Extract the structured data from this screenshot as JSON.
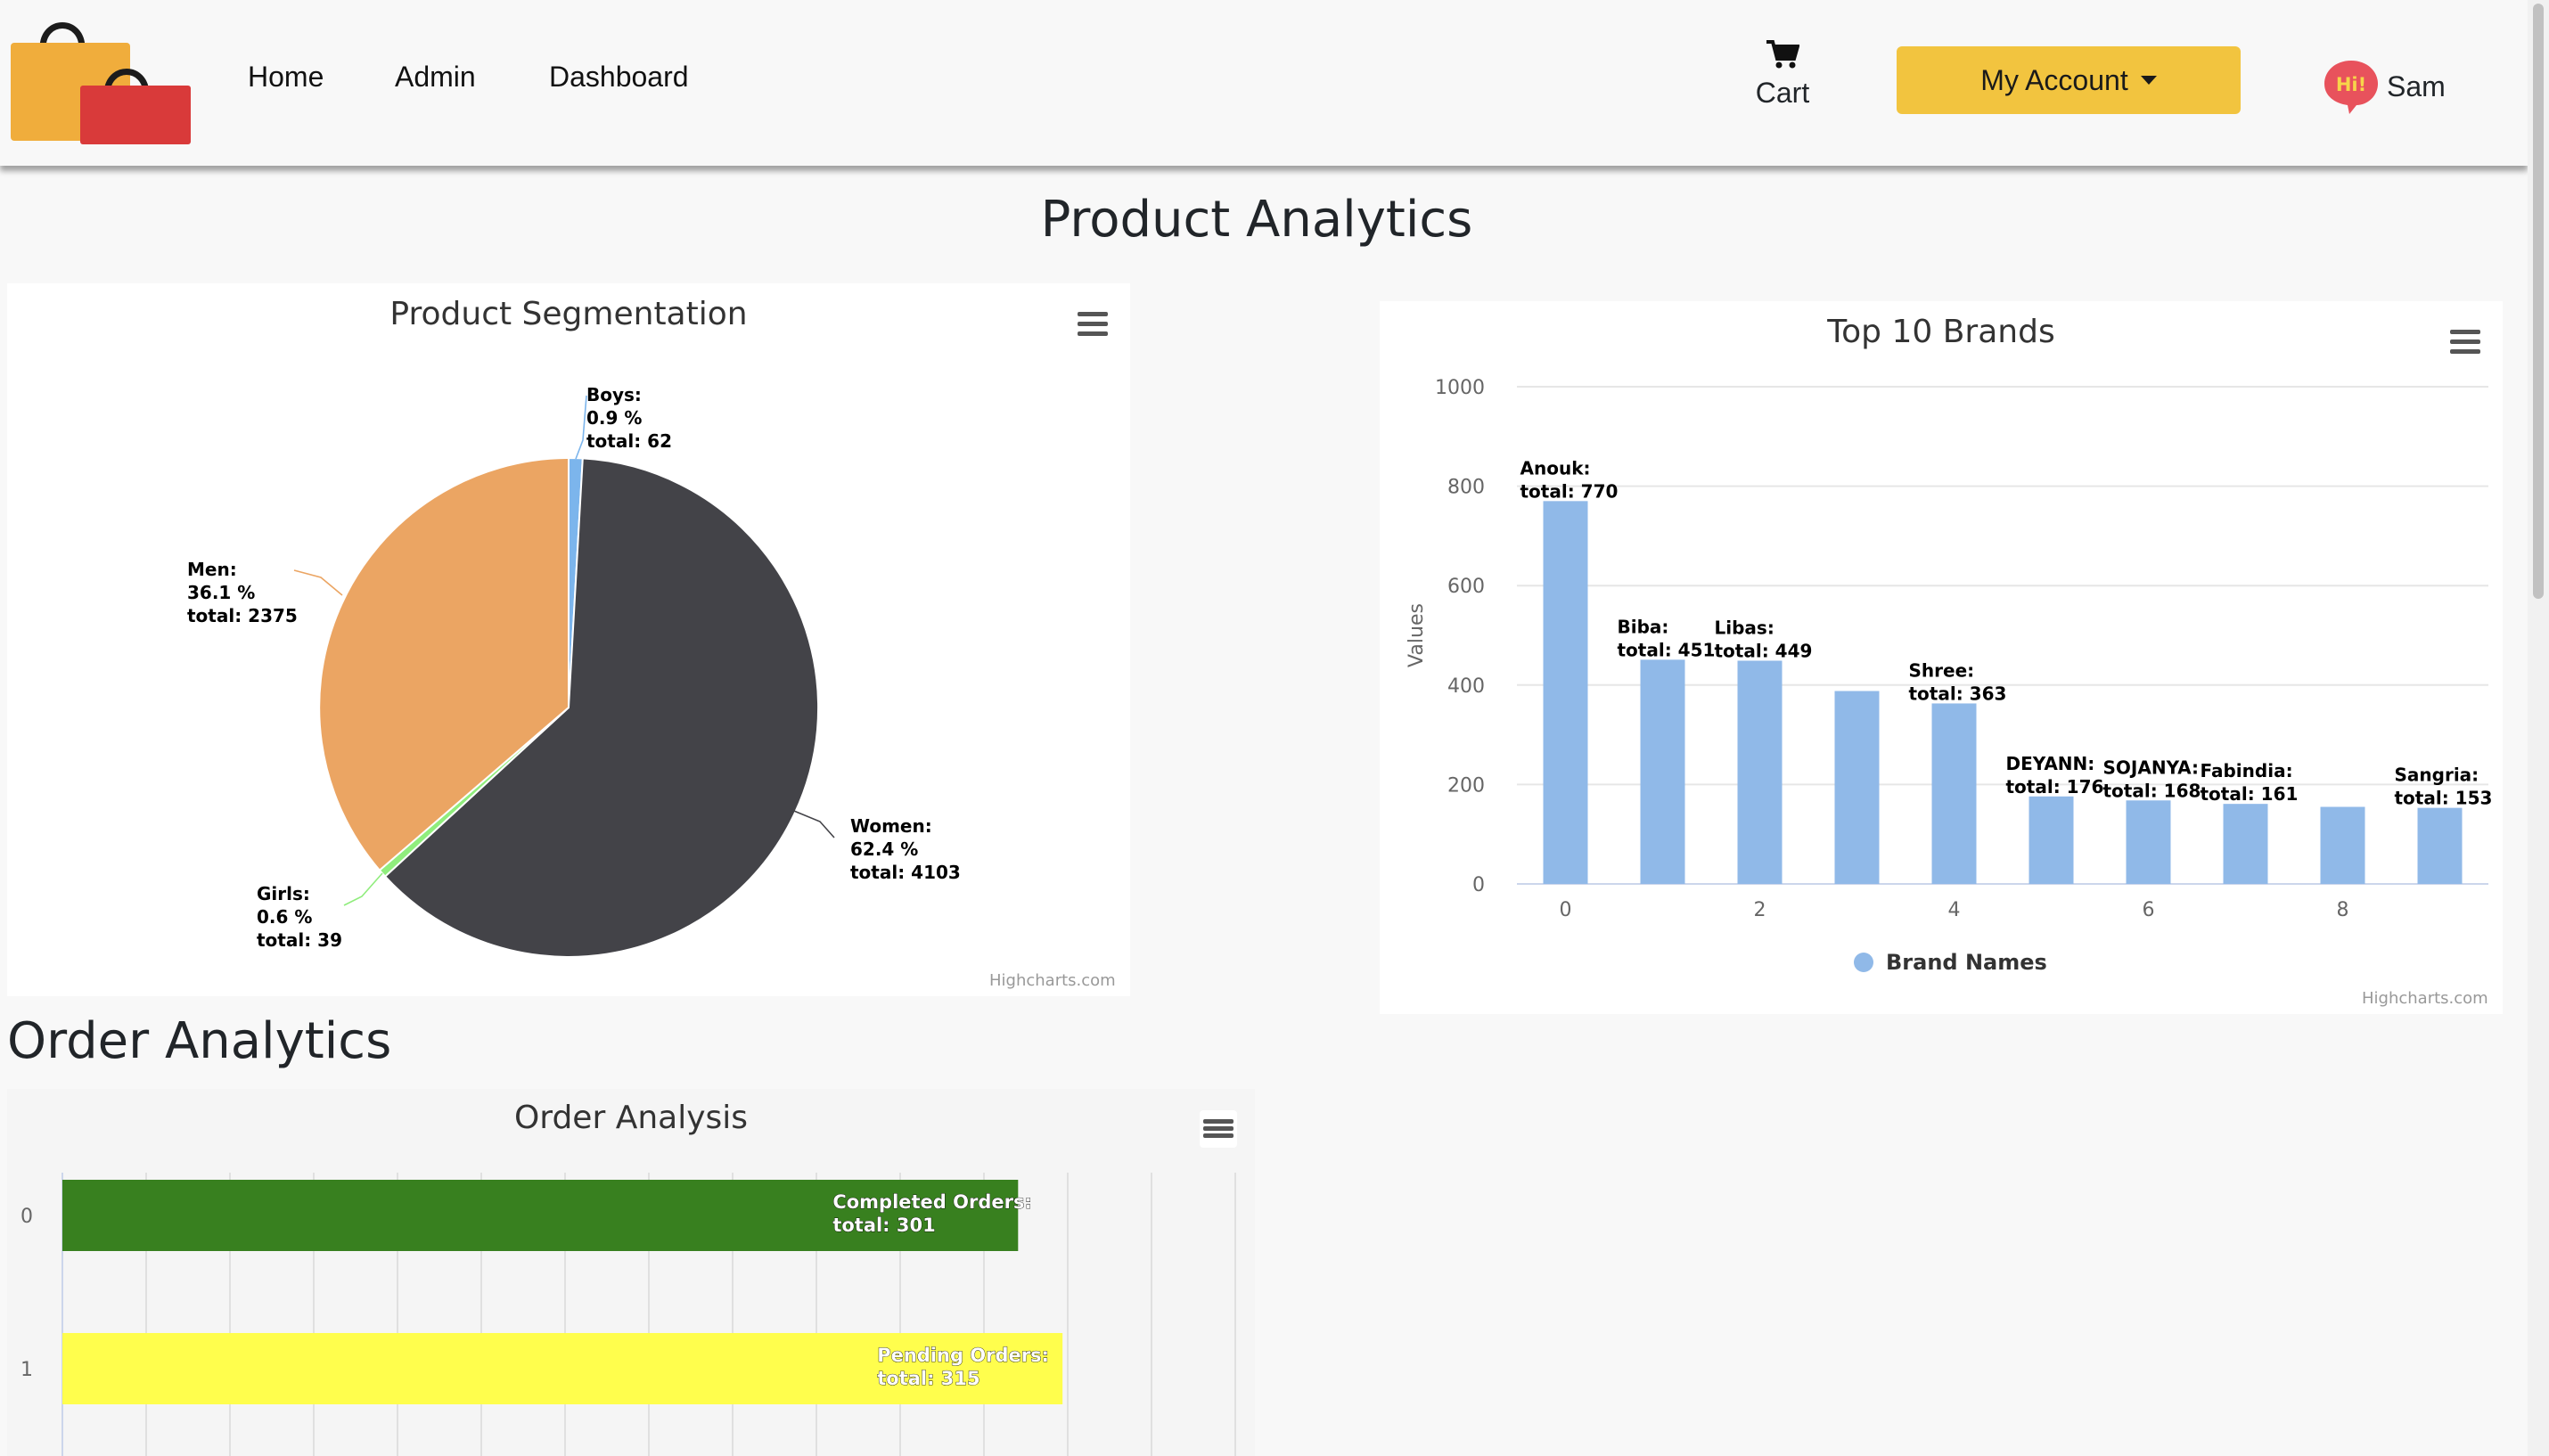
{
  "nav": {
    "home": "Home",
    "admin": "Admin",
    "dashboard": "Dashboard",
    "cart": "Cart",
    "account": "My Account",
    "user": "Sam",
    "user_badge": "Hi!"
  },
  "page_title": "Product Analytics",
  "order_section_title": "Order Analytics",
  "credits": "Highcharts.com",
  "colors": {
    "accent": "#f2c43f",
    "bar_blue": "#90b9e8",
    "women": "#434348",
    "men": "#eba563",
    "boys": "#7cb5ec",
    "girls": "#90ed7d",
    "completed": "#38801f",
    "pending": "#fffe4d"
  },
  "chart_data": [
    {
      "type": "pie",
      "title": "Product Segmentation",
      "slices": [
        {
          "name": "Boys",
          "percent": "0.9 %",
          "total": 62
        },
        {
          "name": "Women",
          "percent": "62.4 %",
          "total": 4103
        },
        {
          "name": "Girls",
          "percent": "0.6 %",
          "total": 39
        },
        {
          "name": "Men",
          "percent": "36.1 %",
          "total": 2375
        }
      ]
    },
    {
      "type": "bar",
      "title": "Top 10 Brands",
      "ylabel": "Values",
      "ylim": [
        0,
        1000
      ],
      "yticks": [
        0,
        200,
        400,
        600,
        800,
        1000
      ],
      "xticks": [
        0,
        2,
        4,
        6,
        8
      ],
      "legend": "Brand Names",
      "categories": [
        "Anouk",
        "Biba",
        "Libas",
        "",
        "Shree",
        "DEYANN",
        "SOJANYA",
        "Fabindia",
        "",
        "Sangria"
      ],
      "values": [
        770,
        451,
        449,
        388,
        363,
        176,
        168,
        161,
        155,
        153
      ],
      "labeled": [
        true,
        true,
        true,
        false,
        true,
        true,
        true,
        true,
        false,
        true
      ]
    },
    {
      "type": "bar",
      "orientation": "horizontal",
      "title": "Order Analysis",
      "categories": [
        "0",
        "1"
      ],
      "series": [
        {
          "name": "Completed Orders",
          "total": 301
        },
        {
          "name": "Pending Orders",
          "total": 315
        }
      ]
    }
  ]
}
